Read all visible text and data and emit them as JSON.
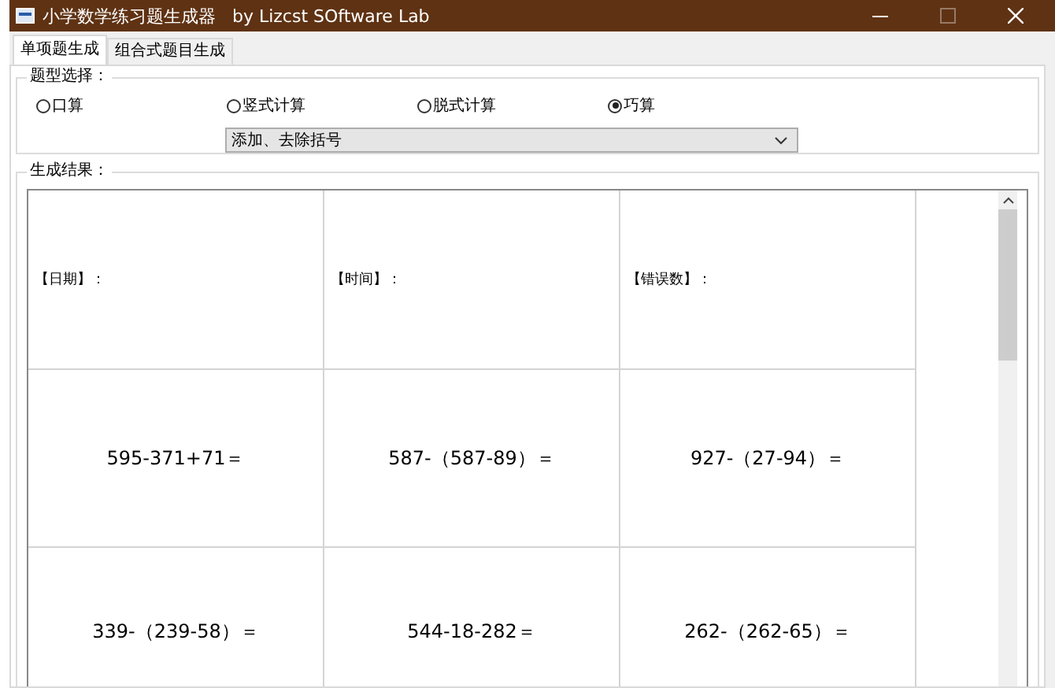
{
  "window": {
    "title": "小学数学练习题生成器   by Lizcst SOftware Lab",
    "maximize_disabled": true
  },
  "tabs": [
    {
      "label": "单项题生成",
      "selected": true
    },
    {
      "label": "组合式题目生成",
      "selected": false
    }
  ],
  "question_type": {
    "label": "题型选择：",
    "options": [
      {
        "label": "口算",
        "selected": false
      },
      {
        "label": "竖式计算",
        "selected": false
      },
      {
        "label": "脱式计算",
        "selected": false
      },
      {
        "label": "巧算",
        "selected": true
      }
    ],
    "dropdown": {
      "value": "添加、去除括号"
    }
  },
  "results": {
    "label": "生成结果：",
    "header_cells": [
      "【日期】：",
      "【时间】：",
      "【错误数】："
    ],
    "rows": [
      [
        "595-371+71＝",
        "587-（587-89）＝",
        "927-（27-94）＝"
      ],
      [
        "339-（239-58）＝",
        "544-18-282＝",
        "262-（262-65）＝"
      ]
    ]
  }
}
